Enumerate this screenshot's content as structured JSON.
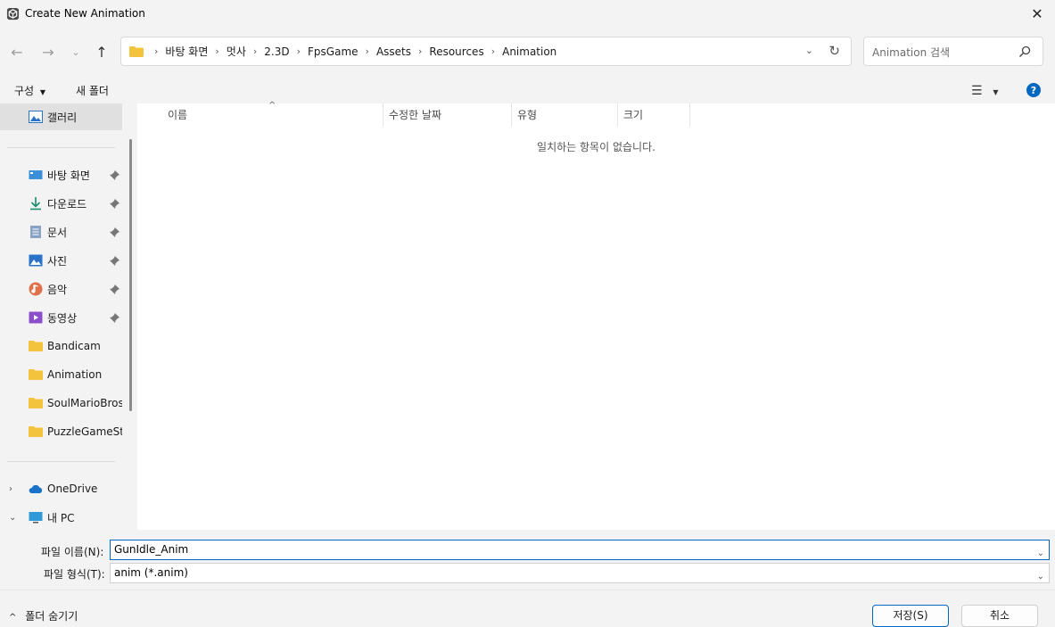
{
  "window": {
    "title": "Create New Animation"
  },
  "nav": {
    "breadcrumbs": [
      "바탕 화면",
      "멋사",
      "2.3D",
      "FpsGame",
      "Assets",
      "Resources",
      "Animation"
    ],
    "search_placeholder": "Animation 검색"
  },
  "toolbar": {
    "organize": "구성",
    "new_folder": "새 폴더"
  },
  "sidebar": {
    "gallery": "갤러리",
    "items": [
      {
        "label": "바탕 화면",
        "icon": "desktop-icon",
        "pinned": true
      },
      {
        "label": "다운로드",
        "icon": "download-icon",
        "pinned": true
      },
      {
        "label": "문서",
        "icon": "documents-icon",
        "pinned": true
      },
      {
        "label": "사진",
        "icon": "pictures-icon",
        "pinned": true
      },
      {
        "label": "음악",
        "icon": "music-icon",
        "pinned": true
      },
      {
        "label": "동영상",
        "icon": "videos-icon",
        "pinned": true
      },
      {
        "label": "Bandicam",
        "icon": "folder-icon",
        "pinned": false
      },
      {
        "label": "Animation",
        "icon": "folder-icon",
        "pinned": false
      },
      {
        "label": "SoulMarioBros",
        "icon": "folder-icon",
        "pinned": false
      },
      {
        "label": "PuzzleGameSta",
        "icon": "folder-icon",
        "pinned": false
      }
    ],
    "onedrive": "OneDrive",
    "this_pc": "내 PC"
  },
  "columns": [
    "이름",
    "수정한 날짜",
    "유형",
    "크기"
  ],
  "empty_message": "일치하는 항목이 없습니다.",
  "file": {
    "name_label": "파일 이름(N):",
    "name_value": "GunIdle_Anim",
    "type_label": "파일 형식(T):",
    "type_value": "anim (*.anim)"
  },
  "footer": {
    "hide_folders": "폴더 숨기기",
    "save": "저장(S)",
    "cancel": "취소"
  },
  "colors": {
    "accent": "#0067c0",
    "folder": "#f4c33d"
  }
}
